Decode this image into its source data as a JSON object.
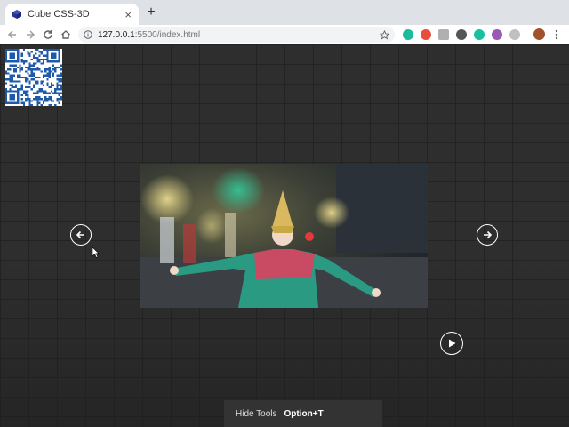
{
  "browser": {
    "tab_title": "Cube CSS-3D",
    "close_glyph": "×",
    "new_tab_glyph": "+",
    "url_host": "127.0.0.1",
    "url_rest": ":5500/index.html",
    "extension_colors": [
      "#1abc9c",
      "#e74c3c",
      "#b0b0b0",
      "#555555",
      "#16c0a0",
      "#9b59b6",
      "#c0c0c0"
    ]
  },
  "page": {
    "icons": {
      "qr": "qr-code-icon",
      "prev": "arrow-left-icon",
      "next": "arrow-right-icon",
      "play": "play-icon"
    }
  },
  "tools_bar": {
    "label": "Hide Tools",
    "shortcut": "Option+T"
  }
}
